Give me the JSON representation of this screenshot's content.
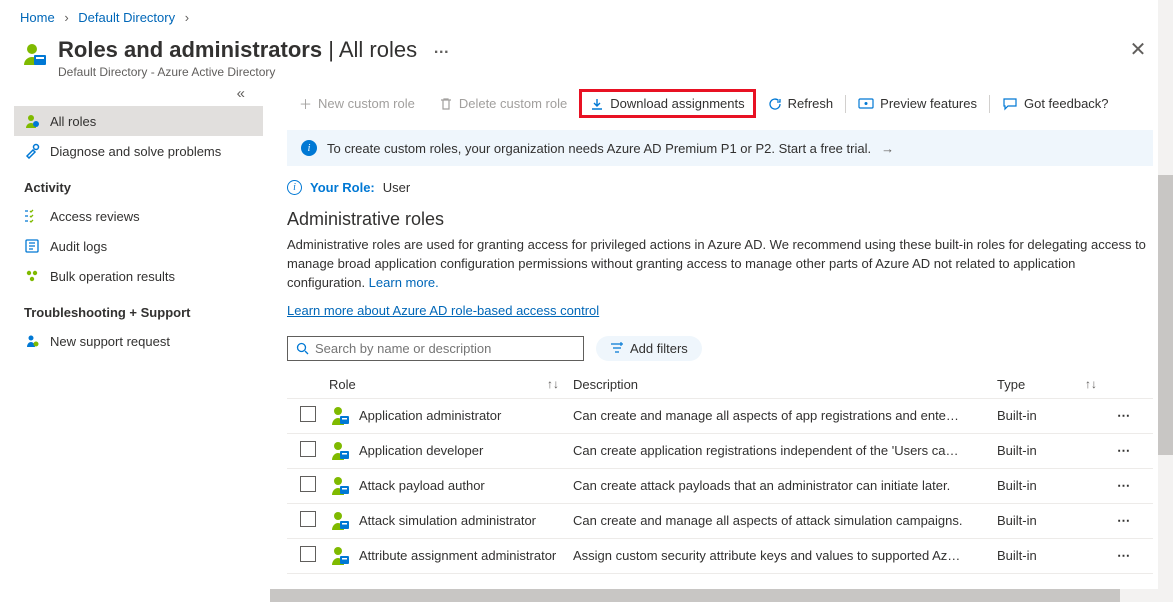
{
  "breadcrumb": {
    "home": "Home",
    "dir": "Default Directory"
  },
  "header": {
    "title_main": "Roles and administrators",
    "title_sub": "All roles",
    "subtitle": "Default Directory - Azure Active Directory"
  },
  "sidebar": {
    "items_top": [
      {
        "label": "All roles",
        "icon": "person"
      },
      {
        "label": "Diagnose and solve problems",
        "icon": "wrench"
      }
    ],
    "section_activity": "Activity",
    "items_activity": [
      {
        "label": "Access reviews",
        "icon": "checklist"
      },
      {
        "label": "Audit logs",
        "icon": "logs"
      },
      {
        "label": "Bulk operation results",
        "icon": "bulk"
      }
    ],
    "section_trouble": "Troubleshooting + Support",
    "items_trouble": [
      {
        "label": "New support request",
        "icon": "support"
      }
    ]
  },
  "toolbar": {
    "new_role": "New custom role",
    "delete_role": "Delete custom role",
    "download": "Download assignments",
    "refresh": "Refresh",
    "preview": "Preview features",
    "feedback": "Got feedback?"
  },
  "banner": {
    "text": "To create custom roles, your organization needs Azure AD Premium P1 or P2. Start a free trial."
  },
  "your_role": {
    "label": "Your Role:",
    "value": "User"
  },
  "section": {
    "heading": "Administrative roles",
    "desc1": "Administrative roles are used for granting access for privileged actions in Azure AD. We recommend using these built-in roles for delegating access to manage broad application configuration permissions without granting access to manage other parts of Azure AD not related to application configuration. ",
    "learn_more": "Learn more.",
    "link2": "Learn more about Azure AD role-based access control"
  },
  "search": {
    "placeholder": "Search by name or description"
  },
  "add_filters": "Add filters",
  "columns": {
    "role": "Role",
    "desc": "Description",
    "type": "Type"
  },
  "rows": [
    {
      "name": "Application administrator",
      "desc": "Can create and manage all aspects of app registrations and ente…",
      "type": "Built-in"
    },
    {
      "name": "Application developer",
      "desc": "Can create application registrations independent of the 'Users ca…",
      "type": "Built-in"
    },
    {
      "name": "Attack payload author",
      "desc": "Can create attack payloads that an administrator can initiate later.",
      "type": "Built-in"
    },
    {
      "name": "Attack simulation administrator",
      "desc": "Can create and manage all aspects of attack simulation campaigns.",
      "type": "Built-in"
    },
    {
      "name": "Attribute assignment administrator",
      "desc": "Assign custom security attribute keys and values to supported Az…",
      "type": "Built-in"
    }
  ]
}
